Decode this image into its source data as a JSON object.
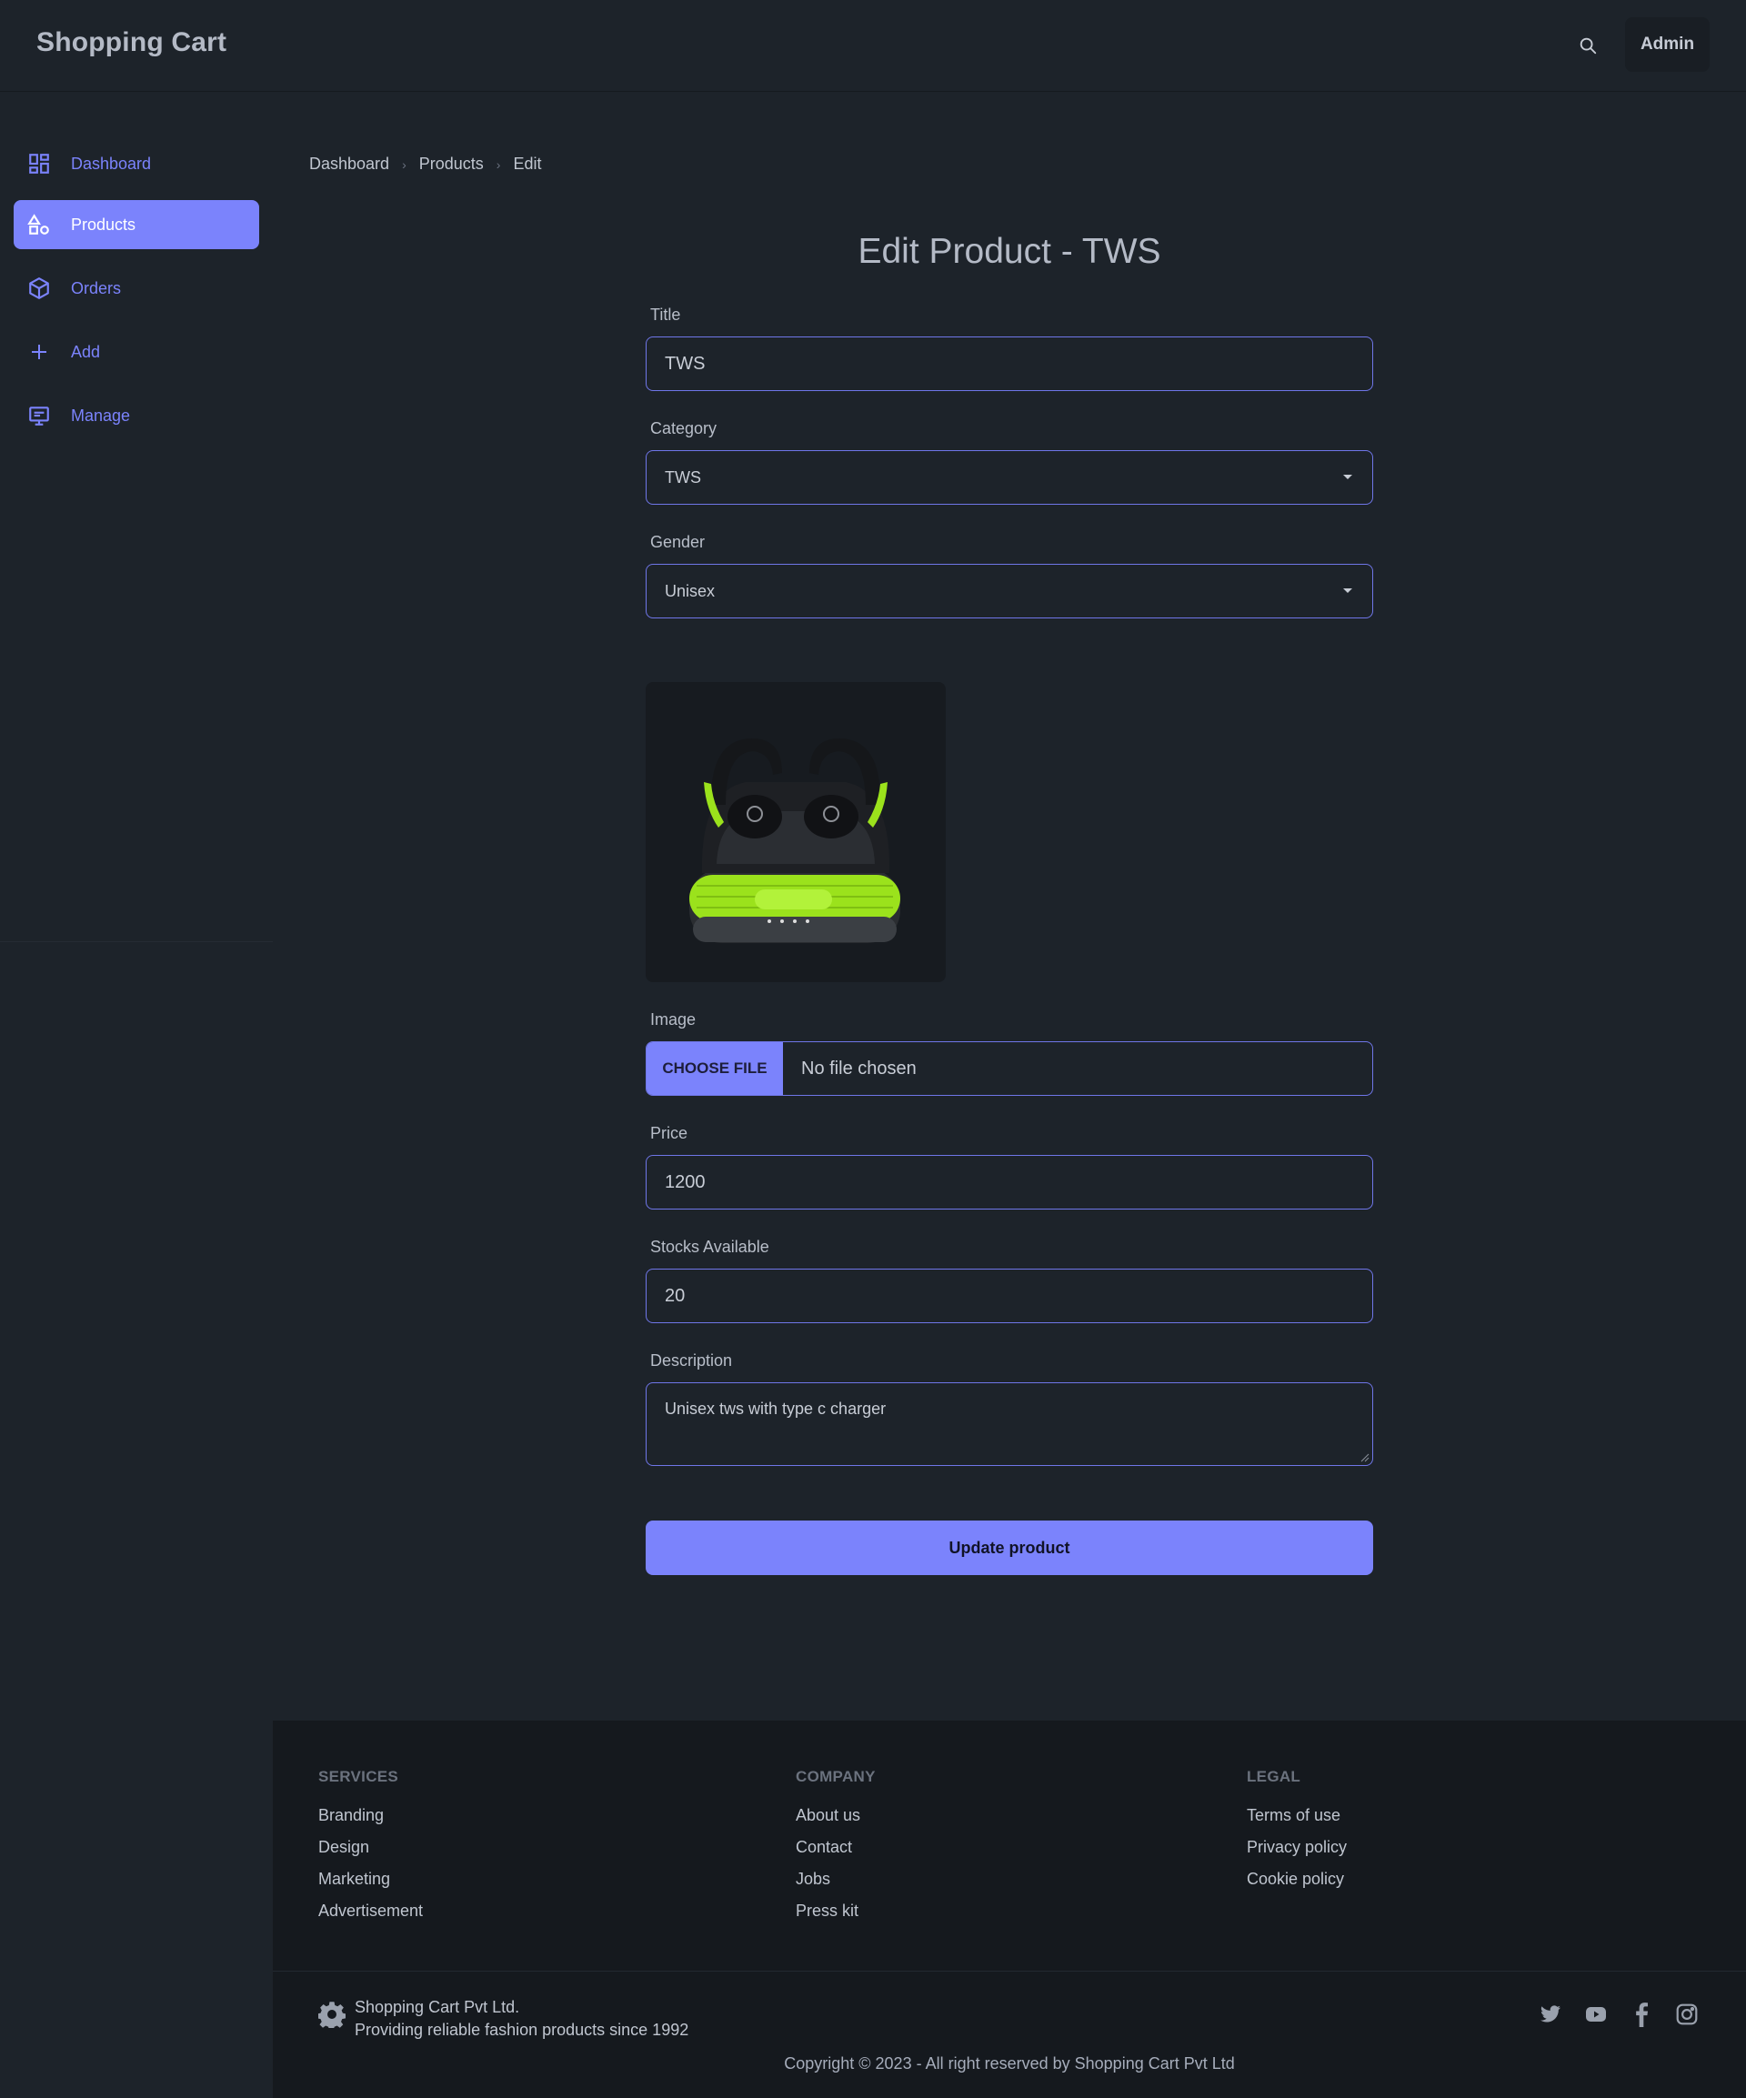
{
  "app": {
    "title": "Shopping Cart",
    "user_label": "Admin"
  },
  "sidebar": {
    "items": [
      {
        "label": "Dashboard",
        "icon": "dashboard-icon",
        "active": false
      },
      {
        "label": "Products",
        "icon": "shapes-icon",
        "active": true
      },
      {
        "label": "Orders",
        "icon": "box-icon",
        "active": false
      },
      {
        "label": "Add",
        "icon": "plus-icon",
        "active": false
      },
      {
        "label": "Manage",
        "icon": "manage-icon",
        "active": false
      }
    ]
  },
  "breadcrumb": [
    "Dashboard",
    "Products",
    "Edit"
  ],
  "form": {
    "heading": "Edit Product - TWS",
    "title_label": "Title",
    "title_value": "TWS",
    "category_label": "Category",
    "category_value": "TWS",
    "gender_label": "Gender",
    "gender_value": "Unisex",
    "image_label": "Image",
    "choose_file_label": "CHOOSE FILE",
    "file_status": "No file chosen",
    "price_label": "Price",
    "price_value": "1200",
    "stock_label": "Stocks Available",
    "stock_value": "20",
    "description_label": "Description",
    "description_value": "Unisex tws with type c charger",
    "submit_label": "Update product"
  },
  "footer": {
    "services": {
      "heading": "SERVICES",
      "links": [
        "Branding",
        "Design",
        "Marketing",
        "Advertisement"
      ]
    },
    "company": {
      "heading": "COMPANY",
      "links": [
        "About us",
        "Contact",
        "Jobs",
        "Press kit"
      ]
    },
    "legal": {
      "heading": "LEGAL",
      "links": [
        "Terms of use",
        "Privacy policy",
        "Cookie policy"
      ]
    },
    "company_name": "Shopping Cart Pvt Ltd.",
    "tagline": "Providing reliable fashion products since 1992",
    "copyright": "Copyright © 2023 - All right reserved by Shopping Cart Pvt Ltd",
    "socials": [
      "twitter-icon",
      "youtube-icon",
      "facebook-icon",
      "instagram-icon"
    ]
  },
  "colors": {
    "accent": "#7b83fc",
    "background": "#1d232a",
    "footer_bg": "#15191e"
  }
}
